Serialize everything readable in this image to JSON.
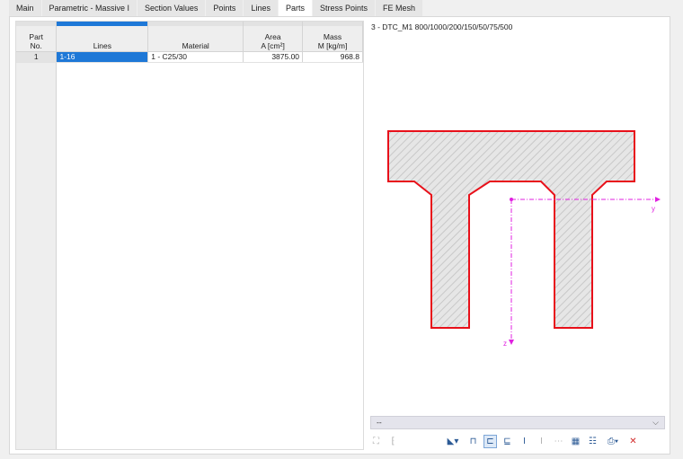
{
  "tabs": [
    {
      "label": "Main",
      "active": false
    },
    {
      "label": "Parametric - Massive I",
      "active": false
    },
    {
      "label": "Section Values",
      "active": false
    },
    {
      "label": "Points",
      "active": false
    },
    {
      "label": "Lines",
      "active": false
    },
    {
      "label": "Parts",
      "active": true
    },
    {
      "label": "Stress Points",
      "active": false
    },
    {
      "label": "FE Mesh",
      "active": false
    }
  ],
  "table": {
    "headers": {
      "part_no": [
        "Part",
        "No."
      ],
      "lines": "Lines",
      "material": "Material",
      "area": [
        "Area",
        "A [cm²]"
      ],
      "mass": [
        "Mass",
        "M [kg/m]"
      ]
    },
    "rows": [
      {
        "part_no": "1",
        "lines": "1-16",
        "material": "1 - C25/30",
        "area": "3875.00",
        "mass": "968.8"
      }
    ]
  },
  "preview": {
    "title": "3 - DTC_M1 800/1000/200/150/50/75/500",
    "axis_y_label": "y",
    "axis_z_label": "z",
    "dropdown_value": "--",
    "colors": {
      "outline": "#e8101a",
      "axis": "#e020e0",
      "hatch": "#d9d9d9"
    }
  },
  "toolbar": {
    "buttons": [
      "select-icon",
      "pin-icon",
      "view-dropdown-icon",
      "section-icon",
      "dimension-icon",
      "centroid-icon",
      "stress-points-icon",
      "axis-icon",
      "line-icon",
      "table-icon",
      "grid-icon",
      "print-icon",
      "reset-icon"
    ]
  }
}
